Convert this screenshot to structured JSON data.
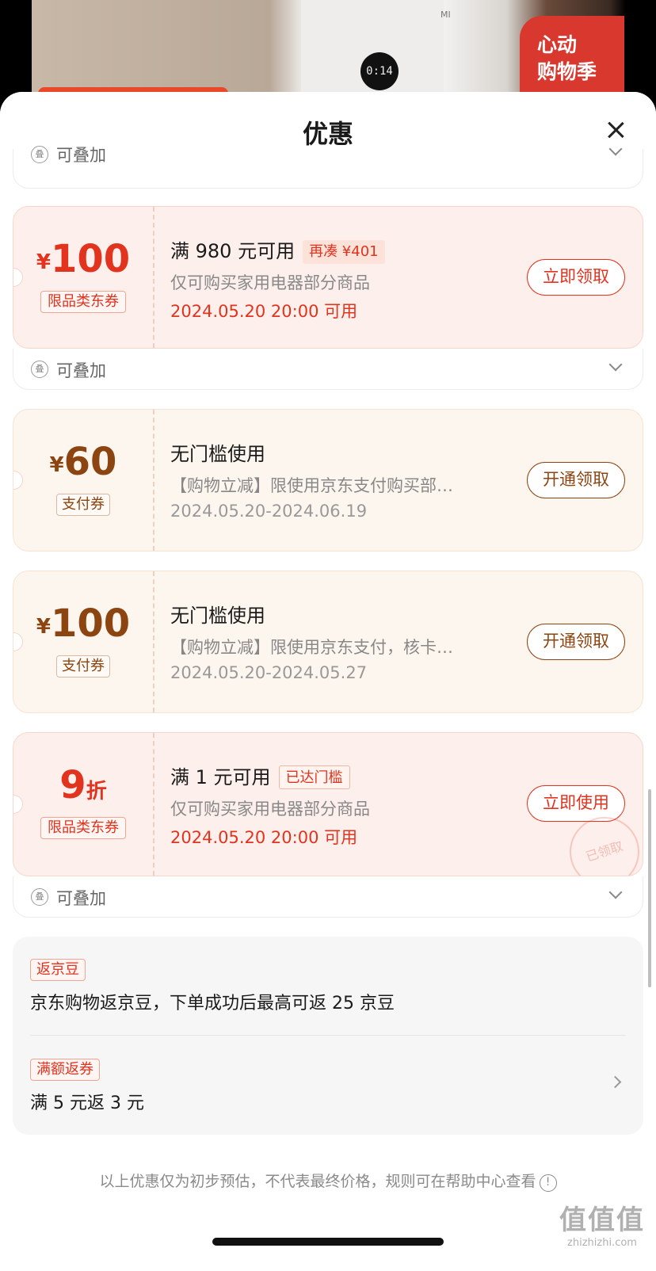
{
  "background": {
    "screen_text": "0:14",
    "brand_logo": "MI",
    "badge_line1": "心动",
    "badge_line2": "购物季"
  },
  "sheet": {
    "title": "优惠"
  },
  "stack_label": "可叠加",
  "coupons": [
    {
      "currency": "¥",
      "amount": "100",
      "type": "限品类东券",
      "title": "满 980 元可用",
      "chip": "再凑 ¥401",
      "desc": "仅可购买家用电器部分商品",
      "date": "2024.05.20 20:00 可用",
      "button": "立即领取"
    },
    {
      "currency": "¥",
      "amount": "60",
      "type": "支付券",
      "title": "无门槛使用",
      "desc": "【购物立减】限使用京东支付购买部…",
      "date": "2024.05.20-2024.06.19",
      "button": "开通领取"
    },
    {
      "currency": "¥",
      "amount": "100",
      "type": "支付券",
      "title": "无门槛使用",
      "desc": "【购物立减】限使用京东支付，核卡…",
      "date": "2024.05.20-2024.05.27",
      "button": "开通领取"
    },
    {
      "amount": "9",
      "unit": "折",
      "type": "限品类东券",
      "title": "满 1 元可用",
      "chip": "已达门槛",
      "desc": "仅可购买家用电器部分商品",
      "date": "2024.05.20 20:00 可用",
      "button": "立即使用",
      "stamp": "已领取"
    }
  ],
  "rebate": {
    "bean_tag": "返京豆",
    "bean_text": "京东购物返京豆，下单成功后最高可返 25 京豆",
    "coupon_tag": "满额返券",
    "coupon_text": "满 5 元返 3 元"
  },
  "footnote": "以上优惠仅为初步预估，不代表最终价格，规则可在帮助中心查看",
  "watermark": {
    "logo": "值值值",
    "url": "zhizhizhi.com"
  },
  "colors": {
    "accent_red": "#e2331f",
    "accent_brown": "#8c4410",
    "coupon_red_bg": "#fdf0ec",
    "coupon_tan_bg": "#fdf6ef"
  },
  "icons": [
    "close-icon",
    "stack-icon",
    "chevron-down-icon",
    "chevron-right-icon",
    "info-icon"
  ]
}
